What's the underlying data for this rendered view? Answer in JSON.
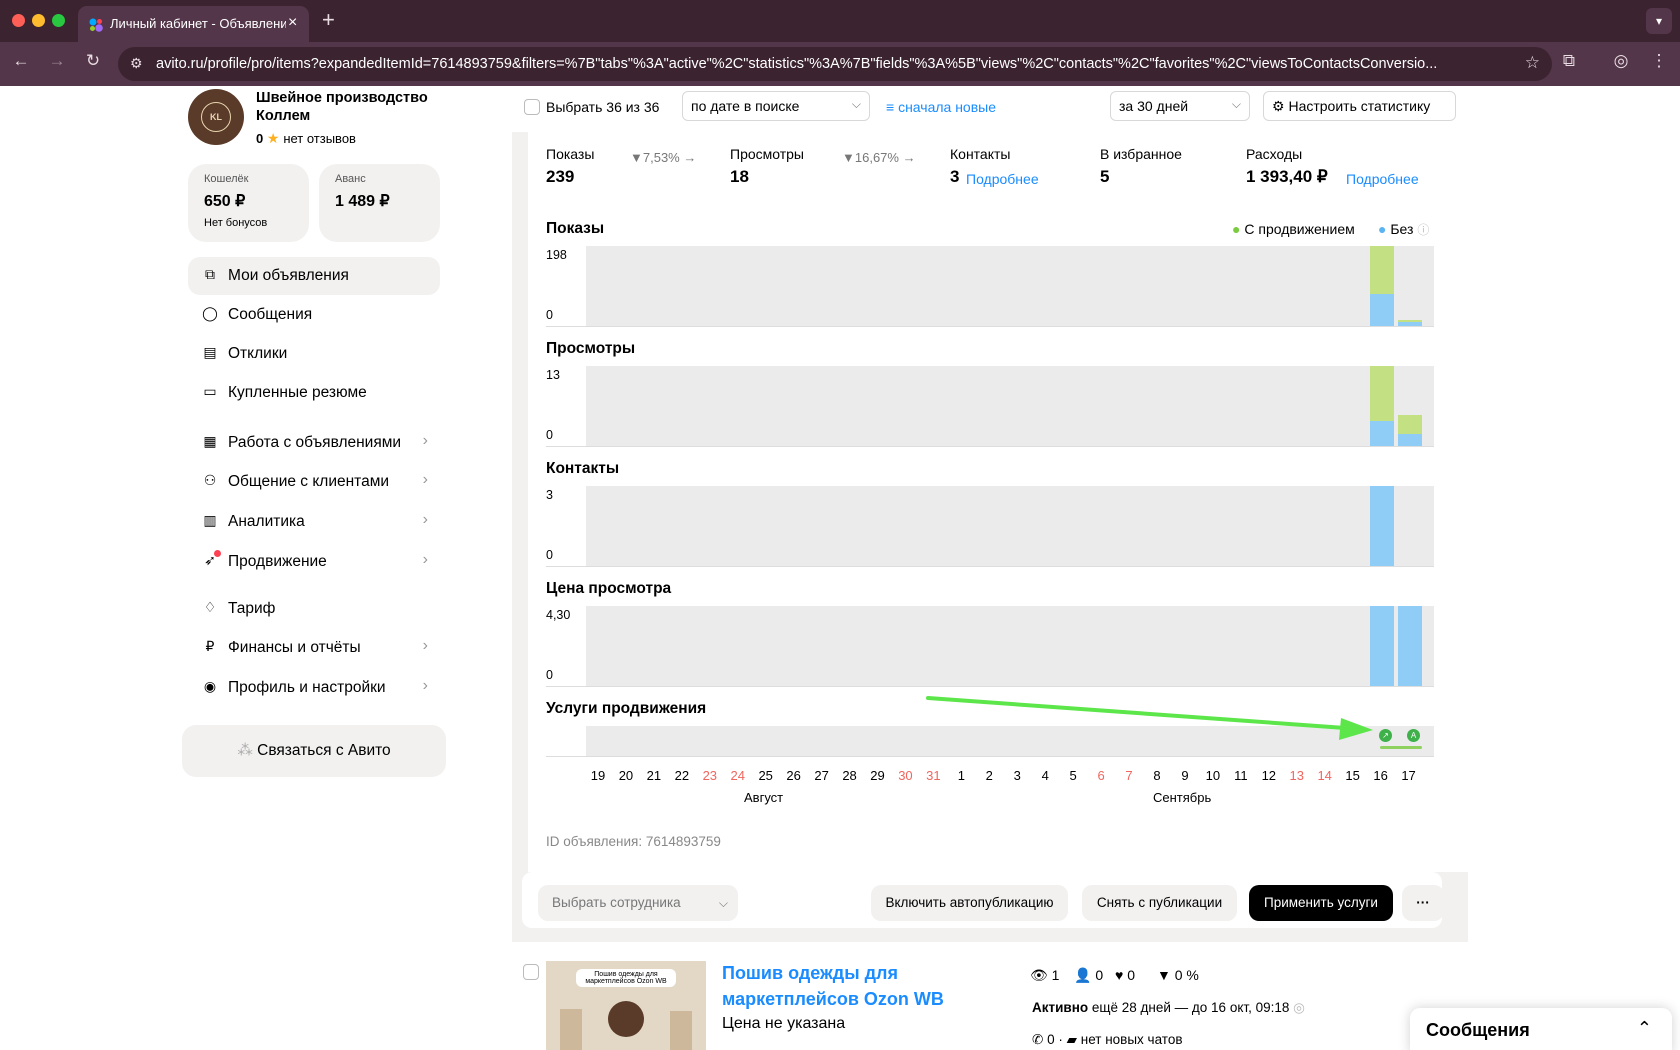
{
  "browser": {
    "tab_title": "Личный кабинет - Объявления",
    "url": "avito.ru/profile/pro/items?expandedItemId=7614893759&filters=%7B\"tabs\"%3A\"active\"%2C\"statistics\"%3A%7B\"fields\"%3A%5B\"views\"%2C\"contacts\"%2C\"favorites\"%2C\"viewsToContactsConversio..."
  },
  "profile": {
    "company": "Швейное производство Коллем",
    "logo_text": "KOLLEM",
    "rating": "0",
    "reviews": "нет отзывов",
    "wallet_caption": "Кошелёк",
    "wallet_value": "650 ₽",
    "wallet_sub": "Нет бонусов",
    "advance_caption": "Аванс",
    "advance_value": "1 489 ₽"
  },
  "sidebar": {
    "items": [
      {
        "label": "Мои объявления",
        "icon": "copy-icon"
      },
      {
        "label": "Сообщения",
        "icon": "chat-icon"
      },
      {
        "label": "Отклики",
        "icon": "responses-icon"
      },
      {
        "label": "Купленные резюме",
        "icon": "resume-icon"
      },
      {
        "label": "Работа с объявлениями",
        "icon": "listing-work-icon"
      },
      {
        "label": "Общение с клиентами",
        "icon": "clients-icon"
      },
      {
        "label": "Аналитика",
        "icon": "analytics-icon"
      },
      {
        "label": "Продвижение",
        "icon": "rocket-icon"
      },
      {
        "label": "Тариф",
        "icon": "tariff-icon"
      },
      {
        "label": "Финансы и отчёты",
        "icon": "ruble-icon"
      },
      {
        "label": "Профиль и настройки",
        "icon": "profile-icon"
      }
    ],
    "contact_button": "Связаться с Авито"
  },
  "toolbar": {
    "select_all": "Выбрать 36 из 36",
    "sort_by": "по дате в поиске",
    "sort_order": "сначала новые",
    "period": "за 30 дней",
    "configure": "Настроить статистику"
  },
  "metrics": {
    "impressions_label": "Показы",
    "impressions_value": "239",
    "impressions_trend": "7,53%",
    "views_label": "Просмотры",
    "views_value": "18",
    "views_trend": "16,67%",
    "contacts_label": "Контакты",
    "contacts_value": "3",
    "contacts_link": "Подробнее",
    "favorites_label": "В избранное",
    "favorites_value": "5",
    "expenses_label": "Расходы",
    "expenses_value": "1 393,40 ₽",
    "expenses_link": "Подробнее"
  },
  "legend": {
    "promoted": "С продвижением",
    "organic": "Без",
    "promoted_color": "#c3e182",
    "organic_color": "#90cdf6"
  },
  "chart_data": [
    {
      "type": "bar",
      "title": "Показы",
      "ylim": [
        0,
        198
      ],
      "yticks": [
        "198",
        "0"
      ],
      "categories": [
        "16",
        "17"
      ],
      "series": [
        {
          "name": "С продвижением",
          "values": [
            120,
            5
          ]
        },
        {
          "name": "Без",
          "values": [
            78,
            11
          ]
        }
      ]
    },
    {
      "type": "bar",
      "title": "Просмотры",
      "ylim": [
        0,
        13
      ],
      "yticks": [
        "13",
        "0"
      ],
      "categories": [
        "16",
        "17"
      ],
      "series": [
        {
          "name": "С продвижением",
          "values": [
            9,
            3
          ]
        },
        {
          "name": "Без",
          "values": [
            4,
            2
          ]
        }
      ]
    },
    {
      "type": "bar",
      "title": "Контакты",
      "ylim": [
        0,
        3
      ],
      "yticks": [
        "3",
        "0"
      ],
      "categories": [
        "16",
        "17"
      ],
      "series": [
        {
          "name": "С продвижением",
          "values": [
            0,
            0
          ]
        },
        {
          "name": "Без",
          "values": [
            3,
            0
          ]
        }
      ]
    },
    {
      "type": "bar",
      "title": "Цена просмотра",
      "ylim": [
        0,
        4.3
      ],
      "yticks": [
        "4,30",
        "0"
      ],
      "categories": [
        "16",
        "17"
      ],
      "series": [
        {
          "name": "Без",
          "values": [
            4.3,
            4.3
          ]
        }
      ]
    }
  ],
  "promo_services_title": "Услуги продвижения",
  "days": [
    {
      "d": "19"
    },
    {
      "d": "20"
    },
    {
      "d": "21"
    },
    {
      "d": "22"
    },
    {
      "d": "23",
      "weekend": true
    },
    {
      "d": "24",
      "weekend": true
    },
    {
      "d": "25"
    },
    {
      "d": "26"
    },
    {
      "d": "27"
    },
    {
      "d": "28"
    },
    {
      "d": "29"
    },
    {
      "d": "30",
      "weekend": true
    },
    {
      "d": "31",
      "weekend": true
    },
    {
      "d": "1"
    },
    {
      "d": "2"
    },
    {
      "d": "3"
    },
    {
      "d": "4"
    },
    {
      "d": "5"
    },
    {
      "d": "6",
      "weekend": true
    },
    {
      "d": "7",
      "weekend": true
    },
    {
      "d": "8"
    },
    {
      "d": "9"
    },
    {
      "d": "10"
    },
    {
      "d": "11"
    },
    {
      "d": "12"
    },
    {
      "d": "13",
      "weekend": true
    },
    {
      "d": "14",
      "weekend": true
    },
    {
      "d": "15"
    },
    {
      "d": "16"
    },
    {
      "d": "17"
    }
  ],
  "months": [
    "Август",
    "Сентябрь"
  ],
  "item_id": "ID объявления: 7614893759",
  "actions": {
    "employee": "Выбрать сотрудника",
    "autopublish": "Включить автопубликацию",
    "unpublish": "Снять с публикации",
    "apply_services": "Применить услуги",
    "more": "···"
  },
  "listing": {
    "thumb_text": "Пошив одежды для маркетплейсов Ozon WB",
    "title": "Пошив одежды для маркетплейсов Ozon WB",
    "price": "Цена не указана",
    "views": "1",
    "contacts": "0",
    "favorites": "0",
    "conversion": "0 %",
    "status": "Активно",
    "status_detail": "ещё 28 дней — до 16 окт, 09:18",
    "calls": "0",
    "chats": "нет новых чатов"
  },
  "messages_panel": {
    "title": "Сообщения"
  }
}
